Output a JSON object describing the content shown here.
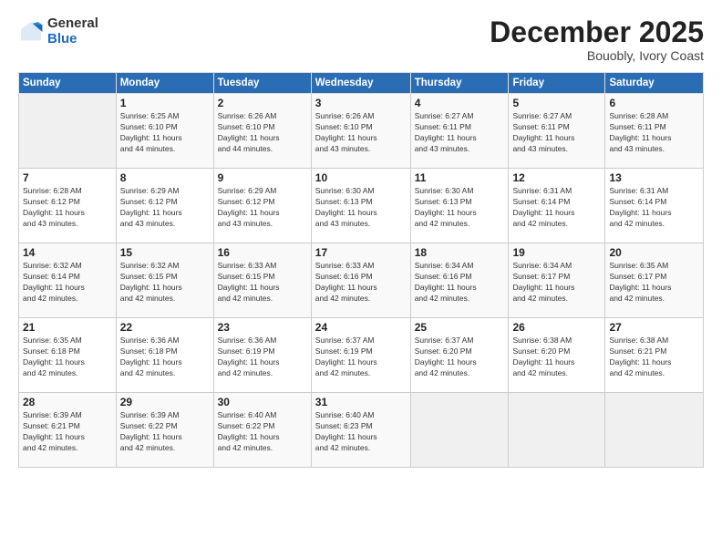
{
  "logo": {
    "general": "General",
    "blue": "Blue"
  },
  "title": {
    "month": "December 2025",
    "location": "Bouobly, Ivory Coast"
  },
  "headers": [
    "Sunday",
    "Monday",
    "Tuesday",
    "Wednesday",
    "Thursday",
    "Friday",
    "Saturday"
  ],
  "weeks": [
    [
      {
        "day": "",
        "info": ""
      },
      {
        "day": "1",
        "info": "Sunrise: 6:25 AM\nSunset: 6:10 PM\nDaylight: 11 hours\nand 44 minutes."
      },
      {
        "day": "2",
        "info": "Sunrise: 6:26 AM\nSunset: 6:10 PM\nDaylight: 11 hours\nand 44 minutes."
      },
      {
        "day": "3",
        "info": "Sunrise: 6:26 AM\nSunset: 6:10 PM\nDaylight: 11 hours\nand 43 minutes."
      },
      {
        "day": "4",
        "info": "Sunrise: 6:27 AM\nSunset: 6:11 PM\nDaylight: 11 hours\nand 43 minutes."
      },
      {
        "day": "5",
        "info": "Sunrise: 6:27 AM\nSunset: 6:11 PM\nDaylight: 11 hours\nand 43 minutes."
      },
      {
        "day": "6",
        "info": "Sunrise: 6:28 AM\nSunset: 6:11 PM\nDaylight: 11 hours\nand 43 minutes."
      }
    ],
    [
      {
        "day": "7",
        "info": "Sunrise: 6:28 AM\nSunset: 6:12 PM\nDaylight: 11 hours\nand 43 minutes."
      },
      {
        "day": "8",
        "info": "Sunrise: 6:29 AM\nSunset: 6:12 PM\nDaylight: 11 hours\nand 43 minutes."
      },
      {
        "day": "9",
        "info": "Sunrise: 6:29 AM\nSunset: 6:12 PM\nDaylight: 11 hours\nand 43 minutes."
      },
      {
        "day": "10",
        "info": "Sunrise: 6:30 AM\nSunset: 6:13 PM\nDaylight: 11 hours\nand 43 minutes."
      },
      {
        "day": "11",
        "info": "Sunrise: 6:30 AM\nSunset: 6:13 PM\nDaylight: 11 hours\nand 42 minutes."
      },
      {
        "day": "12",
        "info": "Sunrise: 6:31 AM\nSunset: 6:14 PM\nDaylight: 11 hours\nand 42 minutes."
      },
      {
        "day": "13",
        "info": "Sunrise: 6:31 AM\nSunset: 6:14 PM\nDaylight: 11 hours\nand 42 minutes."
      }
    ],
    [
      {
        "day": "14",
        "info": "Sunrise: 6:32 AM\nSunset: 6:14 PM\nDaylight: 11 hours\nand 42 minutes."
      },
      {
        "day": "15",
        "info": "Sunrise: 6:32 AM\nSunset: 6:15 PM\nDaylight: 11 hours\nand 42 minutes."
      },
      {
        "day": "16",
        "info": "Sunrise: 6:33 AM\nSunset: 6:15 PM\nDaylight: 11 hours\nand 42 minutes."
      },
      {
        "day": "17",
        "info": "Sunrise: 6:33 AM\nSunset: 6:16 PM\nDaylight: 11 hours\nand 42 minutes."
      },
      {
        "day": "18",
        "info": "Sunrise: 6:34 AM\nSunset: 6:16 PM\nDaylight: 11 hours\nand 42 minutes."
      },
      {
        "day": "19",
        "info": "Sunrise: 6:34 AM\nSunset: 6:17 PM\nDaylight: 11 hours\nand 42 minutes."
      },
      {
        "day": "20",
        "info": "Sunrise: 6:35 AM\nSunset: 6:17 PM\nDaylight: 11 hours\nand 42 minutes."
      }
    ],
    [
      {
        "day": "21",
        "info": "Sunrise: 6:35 AM\nSunset: 6:18 PM\nDaylight: 11 hours\nand 42 minutes."
      },
      {
        "day": "22",
        "info": "Sunrise: 6:36 AM\nSunset: 6:18 PM\nDaylight: 11 hours\nand 42 minutes."
      },
      {
        "day": "23",
        "info": "Sunrise: 6:36 AM\nSunset: 6:19 PM\nDaylight: 11 hours\nand 42 minutes."
      },
      {
        "day": "24",
        "info": "Sunrise: 6:37 AM\nSunset: 6:19 PM\nDaylight: 11 hours\nand 42 minutes."
      },
      {
        "day": "25",
        "info": "Sunrise: 6:37 AM\nSunset: 6:20 PM\nDaylight: 11 hours\nand 42 minutes."
      },
      {
        "day": "26",
        "info": "Sunrise: 6:38 AM\nSunset: 6:20 PM\nDaylight: 11 hours\nand 42 minutes."
      },
      {
        "day": "27",
        "info": "Sunrise: 6:38 AM\nSunset: 6:21 PM\nDaylight: 11 hours\nand 42 minutes."
      }
    ],
    [
      {
        "day": "28",
        "info": "Sunrise: 6:39 AM\nSunset: 6:21 PM\nDaylight: 11 hours\nand 42 minutes."
      },
      {
        "day": "29",
        "info": "Sunrise: 6:39 AM\nSunset: 6:22 PM\nDaylight: 11 hours\nand 42 minutes."
      },
      {
        "day": "30",
        "info": "Sunrise: 6:40 AM\nSunset: 6:22 PM\nDaylight: 11 hours\nand 42 minutes."
      },
      {
        "day": "31",
        "info": "Sunrise: 6:40 AM\nSunset: 6:23 PM\nDaylight: 11 hours\nand 42 minutes."
      },
      {
        "day": "",
        "info": ""
      },
      {
        "day": "",
        "info": ""
      },
      {
        "day": "",
        "info": ""
      }
    ]
  ]
}
